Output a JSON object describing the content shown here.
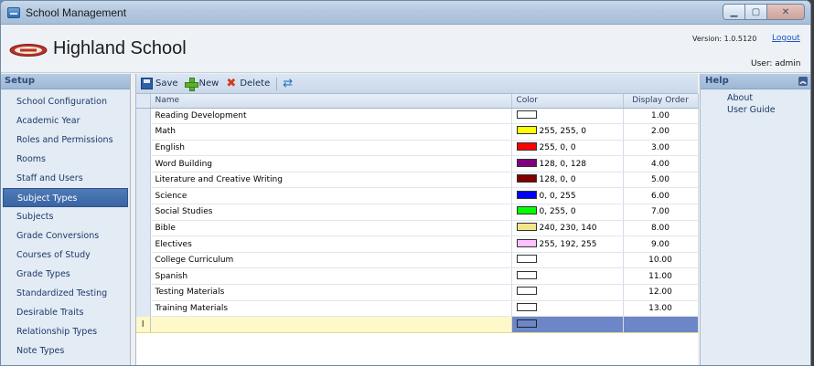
{
  "window": {
    "title": "School Management"
  },
  "header": {
    "school_name": "Highland School",
    "version": "Version: 1.0.5120",
    "logout": "Logout",
    "user": "User: admin"
  },
  "sidebar": {
    "title": "Setup",
    "items": [
      {
        "label": "School Configuration"
      },
      {
        "label": "Academic Year"
      },
      {
        "label": "Roles and Permissions"
      },
      {
        "label": "Rooms"
      },
      {
        "label": "Staff and Users"
      },
      {
        "label": "Subject Types",
        "active": true
      },
      {
        "label": "Subjects"
      },
      {
        "label": "Grade Conversions"
      },
      {
        "label": "Courses of Study"
      },
      {
        "label": "Grade Types"
      },
      {
        "label": "Standardized Testing"
      },
      {
        "label": "Desirable Traits"
      },
      {
        "label": "Relationship Types"
      },
      {
        "label": "Note Types"
      }
    ]
  },
  "toolbar": {
    "save": "Save",
    "new": "New",
    "delete": "Delete"
  },
  "grid": {
    "columns": {
      "name": "Name",
      "color": "Color",
      "order": "Display Order"
    },
    "rows": [
      {
        "name": "Reading Development",
        "color_text": "",
        "swatch": "#ffffff",
        "order": "1.00"
      },
      {
        "name": "Math",
        "color_text": "255, 255, 0",
        "swatch": "#ffff00",
        "order": "2.00"
      },
      {
        "name": "English",
        "color_text": "255, 0, 0",
        "swatch": "#ff0000",
        "order": "3.00"
      },
      {
        "name": "Word Building",
        "color_text": "128, 0, 128",
        "swatch": "#800080",
        "order": "4.00"
      },
      {
        "name": "Literature and Creative Writing",
        "color_text": "128, 0, 0",
        "swatch": "#800000",
        "order": "5.00"
      },
      {
        "name": "Science",
        "color_text": "0, 0, 255",
        "swatch": "#0000ff",
        "order": "6.00"
      },
      {
        "name": "Social Studies",
        "color_text": "0, 255, 0",
        "swatch": "#00ff00",
        "order": "7.00"
      },
      {
        "name": "Bible",
        "color_text": "240, 230, 140",
        "swatch": "#f0e68c",
        "order": "8.00"
      },
      {
        "name": "Electives",
        "color_text": "255, 192, 255",
        "swatch": "#ffc0ff",
        "order": "9.00"
      },
      {
        "name": "College Curriculum",
        "color_text": "",
        "swatch": "#ffffff",
        "order": "10.00"
      },
      {
        "name": "Spanish",
        "color_text": "",
        "swatch": "#ffffff",
        "order": "11.00"
      },
      {
        "name": "Testing Materials",
        "color_text": "",
        "swatch": "#ffffff",
        "order": "12.00"
      },
      {
        "name": "Training Materials",
        "color_text": "",
        "swatch": "#ffffff",
        "order": "13.00"
      }
    ]
  },
  "help": {
    "title": "Help",
    "links": [
      {
        "label": "About"
      },
      {
        "label": "User Guide"
      }
    ]
  },
  "colors": {
    "accent": "#3a64a3",
    "new_row": "#fff8c8",
    "new_color_cell": "#6d86c8"
  }
}
